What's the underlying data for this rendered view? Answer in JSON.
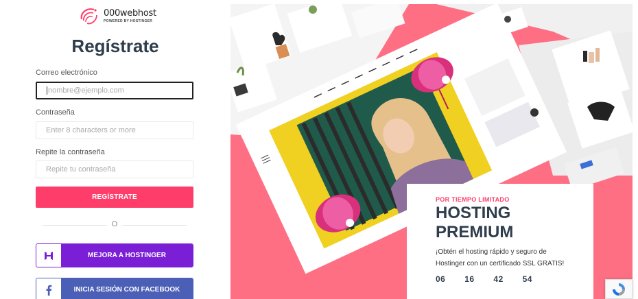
{
  "logo": {
    "name": "000webhost",
    "sub": "POWERED BY HOSTINGER",
    "accent": "#ff3d6a"
  },
  "form": {
    "title": "Regístrate",
    "email_label": "Correo electrónico",
    "email_placeholder": "nombre@ejemplo.com",
    "password_label": "Contraseña",
    "password_placeholder": "Enter 8 characters or more",
    "repeat_label": "Repite la contraseña",
    "repeat_placeholder": "Repite tu contraseña",
    "submit_label": "REGÍSTRATE",
    "divider_text": "O"
  },
  "social": {
    "hostinger_label": "MEJORA A HOSTINGER",
    "hostinger_icon": "hostinger-logo-icon",
    "facebook_label": "INICIA SESIÓN CON FACEBOOK",
    "facebook_icon": "facebook-icon"
  },
  "promo": {
    "tag": "POR TIEMPO LIMITADO",
    "title_line1": "HOSTING",
    "title_line2": "PREMIUM",
    "description": "¡Obtén el hosting rápido y seguro de Hostinger con un certificado SSL GRATIS!",
    "countdown": [
      "06",
      "16",
      "42",
      "54"
    ]
  },
  "colors": {
    "brand_pink": "#ff3d6a",
    "hostinger_purple": "#7a1fd6",
    "facebook_blue": "#4b5fb6",
    "panel_pink": "#ff6f84",
    "title_dark": "#2f3d4c"
  }
}
